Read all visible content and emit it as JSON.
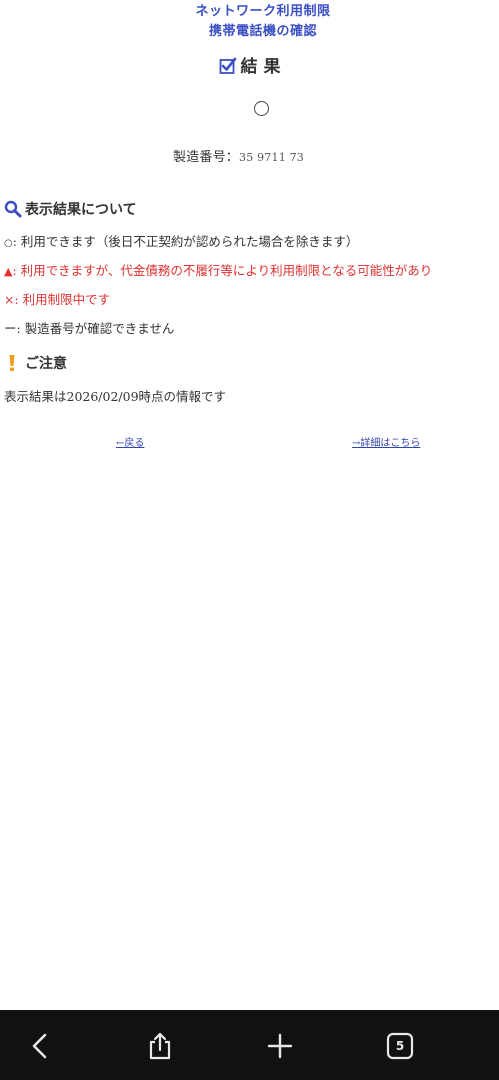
{
  "header": {
    "line1": "ネットワーク利用制限",
    "line2": "携帯電話機の確認"
  },
  "result": {
    "heading": "結 果",
    "heading_icon": "checkbox-checked-icon",
    "mark": "○"
  },
  "serial": {
    "label": "製造番号：",
    "value": "35  9711  73"
  },
  "legend": {
    "heading": "表示結果について",
    "heading_icon": "magnifier-icon",
    "items": [
      {
        "symbol": "○",
        "text": ": 利用できます（後日不正契約が認められた場合を除きます）",
        "color": "#333333"
      },
      {
        "symbol": "▲",
        "text": ": 利用できますが、代金債務の不履行等により利用制限となる可能性があり",
        "color": "#e03030"
      },
      {
        "symbol": "×",
        "text": ": 利用制限中です",
        "color": "#e03030"
      },
      {
        "symbol": "ー",
        "text": ": 製造番号が確認できません",
        "color": "#333333"
      }
    ]
  },
  "notice": {
    "heading": "ご注意",
    "heading_icon": "exclamation-icon",
    "text": "表示結果は2026/02/09時点の情報です"
  },
  "links": {
    "back": "←戻る",
    "details": "→詳細はこちら"
  },
  "browser_bar": {
    "back_icon": "chevron-left-icon",
    "share_icon": "share-icon",
    "new_tab_icon": "plus-icon",
    "tab_count": "5"
  },
  "colors": {
    "title_blue": "#3a4fc4",
    "warning_red": "#e03030",
    "accent_orange": "#f0a020",
    "link_blue": "#3344aa"
  }
}
